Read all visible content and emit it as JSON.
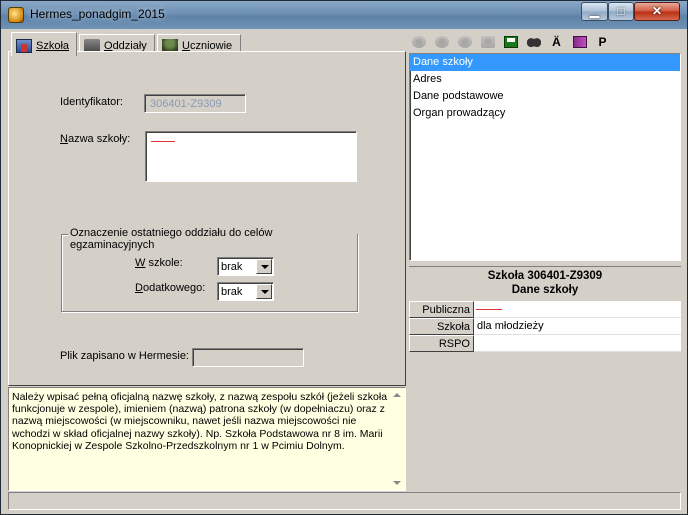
{
  "window": {
    "title": "Hermes_ponadgim_2015"
  },
  "tabs": [
    {
      "label": "Szkoła",
      "icon": "school-icon",
      "active": true
    },
    {
      "label": "Oddziały",
      "icon": "class-icon",
      "active": false
    },
    {
      "label": "Uczniowie",
      "icon": "students-icon",
      "active": false
    }
  ],
  "form": {
    "identifier_label": "Identyfikator:",
    "identifier_value": "306401-Z9309",
    "name_label": "Nazwa szkoły:",
    "name_value": "",
    "group_title": "Oznaczenie ostatniego oddziału do celów egzaminacyjnych",
    "w_szkole_label": "W szkole:",
    "w_szkole_value": "brak",
    "dodatkowego_label": "Dodatkowego:",
    "dodatkowego_value": "brak",
    "saved_label": "Plik zapisano w Hermesie:",
    "saved_value": ""
  },
  "hint": {
    "text": "Należy wpisać pełną oficjalną nazwę szkoły, z nazwą zespołu szkół (jeżeli szkoła funkcjonuje w zespole), imieniem (nazwą) patrona szkoły (w dopełniaczu) oraz z nazwą miejscowości (w miejscowniku, nawet jeśli nazwa miejscowości nie wchodzi w skład oficjalnej nazwy szkoły). Np. Szkoła Podstawowa nr 8 im. Marii Konopnickiej w Zespole Szkolno-Przedszkolnym nr 1 w Pcimiu Dolnym."
  },
  "toolbar": {
    "icons": [
      "people-plus-icon",
      "people-group-icon",
      "people-move-icon",
      "copy-icon",
      "save-icon",
      "binoculars-icon",
      "a-umlaut-icon",
      "book-icon",
      "p-icon"
    ],
    "a_label": "Ä",
    "p_label": "P"
  },
  "tree": {
    "items": [
      "Dane szkoły",
      "Adres",
      "Dane podstawowe",
      "Organ prowadzący"
    ],
    "selected_index": 0
  },
  "info": {
    "title": "Szkoła 306401-Z9309",
    "subtitle": "Dane szkoły"
  },
  "properties": [
    {
      "key": "Publiczna",
      "value": ""
    },
    {
      "key": "Szkoła",
      "value": "dla młodzieży"
    },
    {
      "key": "RSPO",
      "value": ""
    }
  ]
}
